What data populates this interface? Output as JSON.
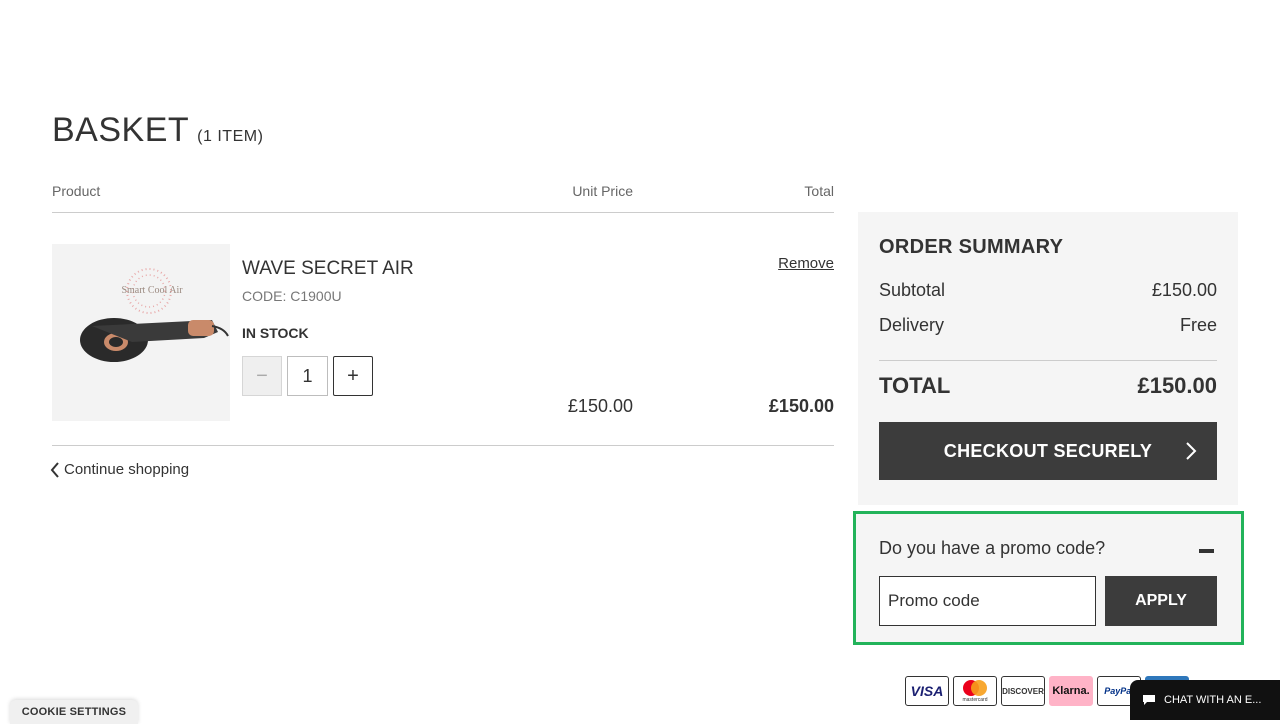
{
  "page": {
    "title": "BASKET",
    "item_count": "(1 ITEM)"
  },
  "table": {
    "headers": {
      "product": "Product",
      "unit_price": "Unit Price",
      "total": "Total"
    }
  },
  "item": {
    "thumb_text": "Smart Cool Air",
    "name": "WAVE SECRET AIR",
    "code": "CODE: C1900U",
    "stock": "IN STOCK",
    "quantity": "1",
    "minus_symbol": "−",
    "plus_symbol": "+",
    "remove_label": "Remove",
    "unit_price": "£150.00",
    "total": "£150.00"
  },
  "continue_label": "Continue shopping",
  "summary": {
    "title": "ORDER SUMMARY",
    "subtotal_label": "Subtotal",
    "subtotal_value": "£150.00",
    "delivery_label": "Delivery",
    "delivery_value": "Free",
    "total_label": "TOTAL",
    "total_value": "£150.00",
    "checkout_label": "CHECKOUT SECURELY"
  },
  "promo": {
    "question": "Do you have a promo code?",
    "placeholder": "Promo code",
    "apply_label": "APPLY"
  },
  "payments": [
    "VISA",
    "mastercard",
    "DISCOVER",
    "Klarna.",
    "PayPal"
  ],
  "cookie_label": "COOKIE SETTINGS",
  "chat_label": "CHAT WITH AN E...",
  "colors": {
    "dark_button": "#3c3c3c",
    "summary_bg": "#f5f5f5",
    "highlight": "#22b35a",
    "klarna_pink": "#ffb3c7",
    "chat_bg": "#111111"
  }
}
